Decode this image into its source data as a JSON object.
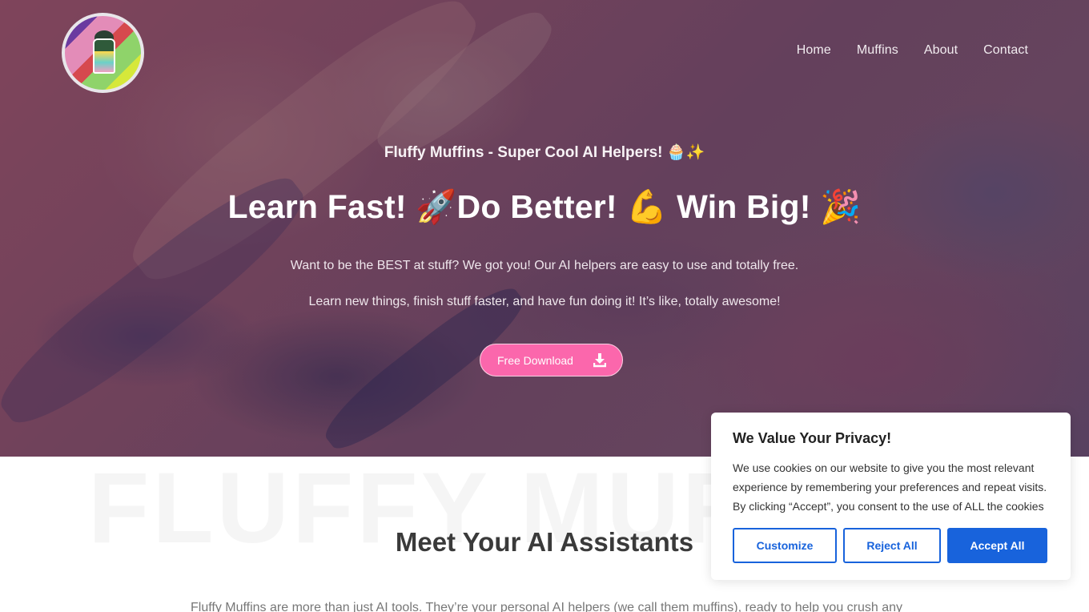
{
  "brand": {
    "logo_alt": "Fluffy Muffins logo"
  },
  "nav": {
    "items": [
      {
        "label": "Home"
      },
      {
        "label": "Muffins"
      },
      {
        "label": "About"
      },
      {
        "label": "Contact"
      }
    ]
  },
  "hero": {
    "tagline": "Fluffy Muffins - Super Cool AI Helpers! 🧁✨",
    "headline": "Learn Fast! 🚀Do Better! 💪 Win Big! 🎉",
    "paragraph_1": "Want to be the BEST at stuff? We got you! Our AI helpers are easy to use and totally free.",
    "paragraph_2": "Learn new things, finish stuff faster, and have fun doing it! It’s like, totally awesome!",
    "cta_label": "Free Download",
    "cta_icon": "download-icon"
  },
  "section": {
    "watermark": "FLUFFY MUFFINS",
    "title": "Meet Your AI Assistants",
    "text": "Fluffy Muffins are more than just AI tools. They’re your personal AI helpers (we call them muffins), ready to help you crush any"
  },
  "cookie_banner": {
    "title": "We Value Your Privacy!",
    "body": "We use cookies on our website to give you the most relevant experience by remembering your preferences and repeat visits. By clicking “Accept”, you consent to the use of ALL the cookies",
    "customize_label": "Customize",
    "reject_label": "Reject All",
    "accept_label": "Accept All"
  },
  "colors": {
    "cta_pink": "#fb67ac",
    "cookie_blue": "#1863dc"
  }
}
